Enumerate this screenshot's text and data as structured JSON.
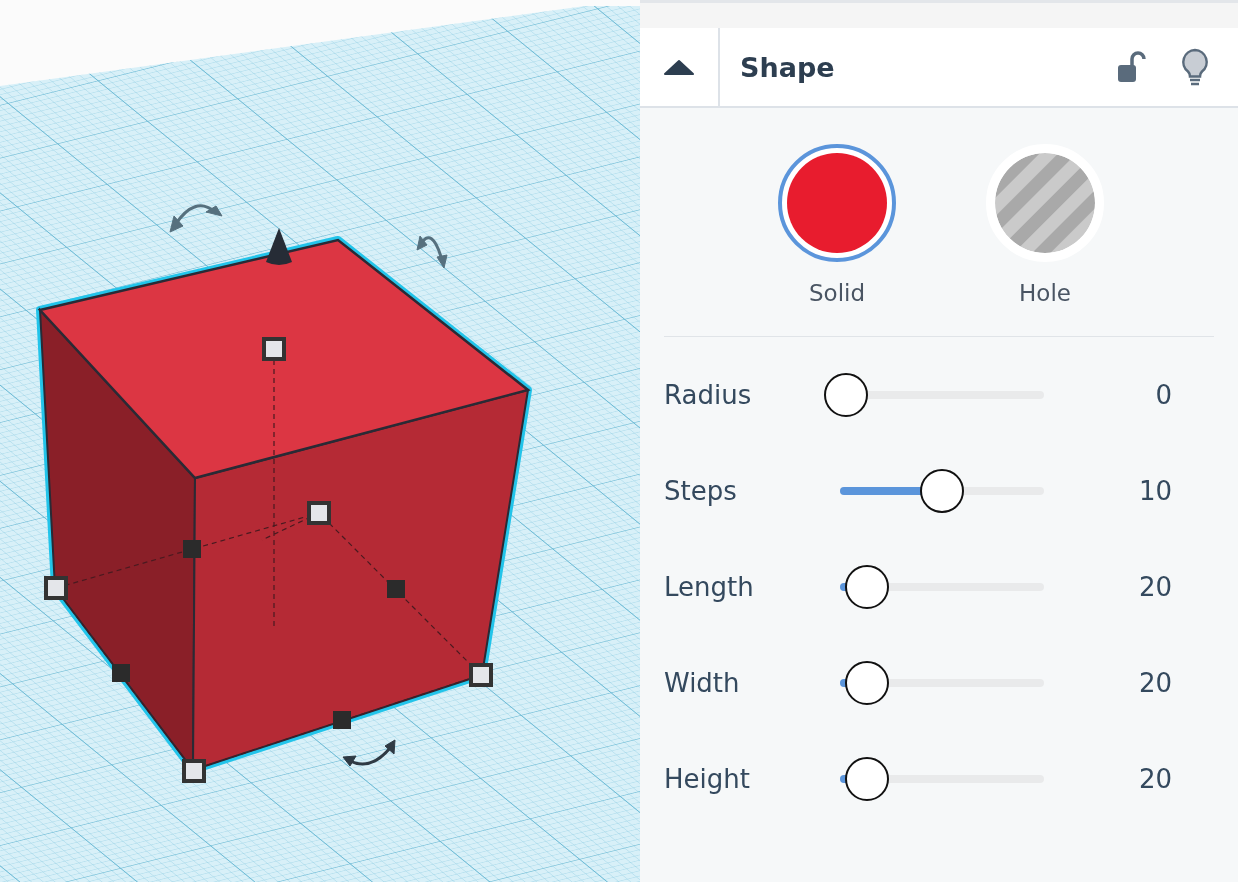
{
  "panel": {
    "title": "Shape",
    "locked": false
  },
  "shape_types": [
    {
      "label": "Solid",
      "kind": "solid",
      "selected": true
    },
    {
      "label": "Hole",
      "kind": "hole",
      "selected": false
    }
  ],
  "parameters": [
    {
      "name": "Radius",
      "level": 0.03,
      "reading": "0"
    },
    {
      "name": "Steps",
      "level": 0.5,
      "reading": "10"
    },
    {
      "name": "Length",
      "level": 0.13,
      "reading": "20"
    },
    {
      "name": "Width",
      "level": 0.13,
      "reading": "20"
    },
    {
      "name": "Height",
      "level": 0.13,
      "reading": "20"
    }
  ]
}
